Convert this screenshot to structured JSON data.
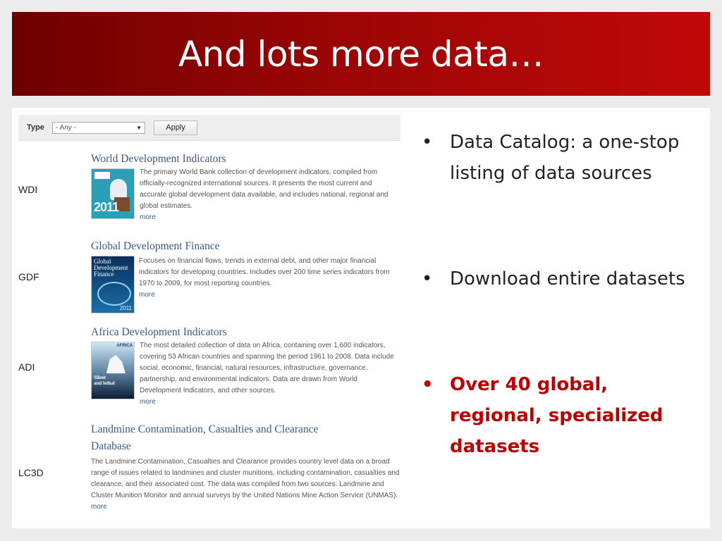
{
  "slide": {
    "title": "And lots more data…"
  },
  "filter": {
    "label": "Type",
    "select_value": "- Any -",
    "apply_label": "Apply"
  },
  "entries": [
    {
      "abbr": "WDI",
      "title": "World Development Indicators",
      "cover_text": "2011",
      "description": "The primary World Bank collection of development indicators, compiled from officially-recognized international sources. It presents the most current and accurate global development data available, and includes national, regional and global estimates.",
      "more": "more"
    },
    {
      "abbr": "GDF",
      "title": "Global Development Finance",
      "cover_text": "Global Development Finance",
      "cover_year": "2011",
      "description": "Focuses on financial flows, trends in external debt, and other major financial indicators for developing countries. Includes over 200 time series indicators from 1970 to 2009, for most reporting countries.",
      "more": "more"
    },
    {
      "abbr": "ADI",
      "title": "Africa Development Indicators",
      "cover_text": "Silent and lethal",
      "cover_badge": "AFRICA",
      "description": "The most detailed collection of data on Africa, containing over 1,600 indicators, covering 53 African countries and spanning the period 1961 to 2008. Data include social, economic, financial, natural resources, infrastructure, governance, partnership, and environmental indicators. Data are drawn from World Development Indicators, and other sources.",
      "more": "more"
    },
    {
      "abbr": "LC3D",
      "title_line1": "Landmine Contamination, Casualties and Clearance",
      "title_line2": "Database",
      "description": "The Landmine Contamination, Casualties and Clearance provides country level data on a broad range of issues related to landmines and cluster munitions, including contamination, casualties and clearance, and their associated cost. The data was compiled from two sources: Landmine and Cluster Munition Monitor and annual surveys by the United Nations Mine Action Service (UNMAS).",
      "more": "more"
    }
  ],
  "bullets": [
    {
      "dot": "•",
      "text": "Data Catalog: a one-stop listing of data sources"
    },
    {
      "dot": "•",
      "text": "Download entire datasets"
    },
    {
      "dot": "•",
      "text": "Over 40 global, regional, specialized datasets"
    }
  ],
  "colors": {
    "title_bar": "#9a0505",
    "link": "#3a5a86",
    "highlight": "#c00000"
  }
}
